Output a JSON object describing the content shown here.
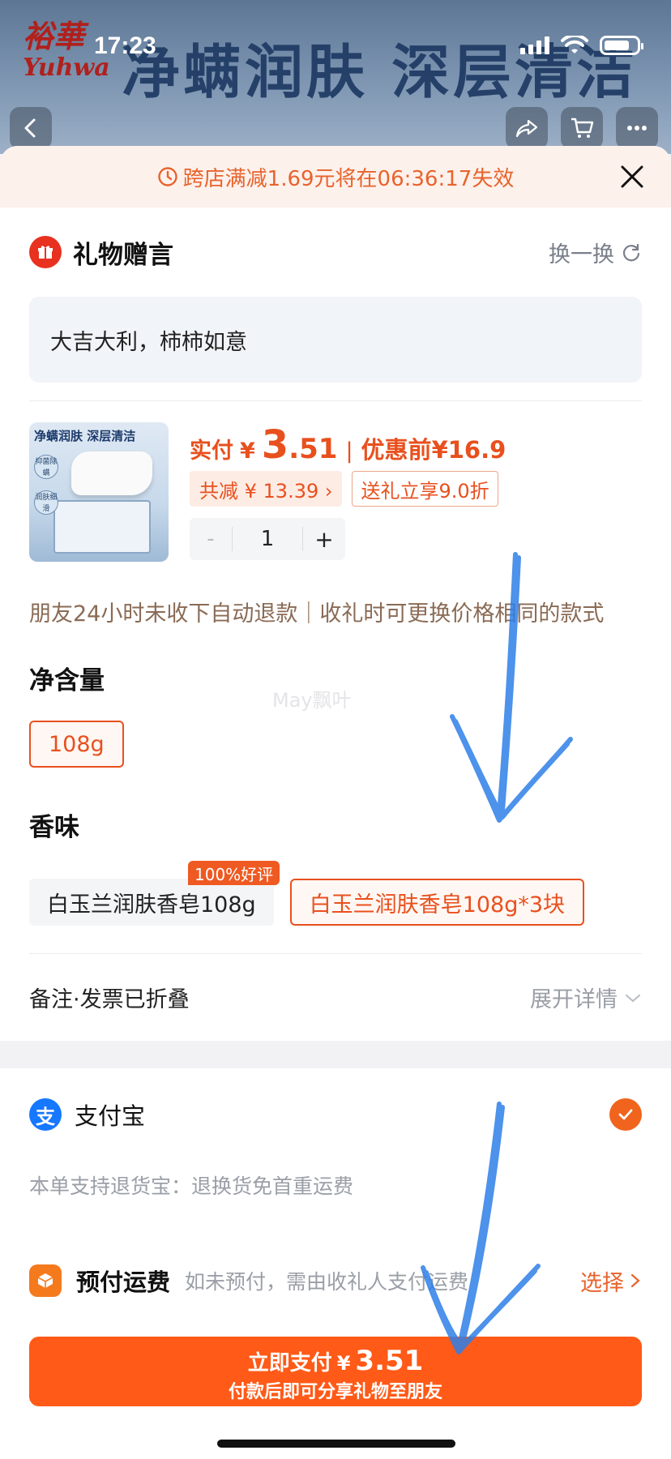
{
  "status_bar": {
    "time": "17:23"
  },
  "hero": {
    "brand_cn": "裕華",
    "brand_en": "Yuhwa",
    "title": "净螨润肤 深层清洁"
  },
  "promo": {
    "text": "跨店满减1.69元将在06:36:17失效"
  },
  "gift": {
    "title": "礼物赠言",
    "swap_label": "换一换",
    "message": "大吉大利，柿柿如意"
  },
  "product": {
    "thumb_title": "净螨润肤 深层清洁",
    "thumb_tags": [
      "抑菌除螨",
      "润肤细滑"
    ],
    "actual_label": "实付",
    "currency": "¥",
    "price_int": "3",
    "price_dec": ".51",
    "separator": "|",
    "before_label": "优惠前",
    "before_price": "¥16.9",
    "discount_chip": "共减 ¥ 13.39 ›",
    "gift_chip": "送礼立享9.0折",
    "qty_minus": "-",
    "qty": "1",
    "qty_plus": "+"
  },
  "notice": "朋友24小时未收下自动退款｜收礼时可更换价格相同的款式",
  "specs": {
    "net_label": "净含量",
    "net_options": [
      "108g"
    ],
    "scent_label": "香味",
    "scent_options": [
      "白玉兰润肤香皂108g",
      "白玉兰润肤香皂108g*3块"
    ],
    "badge": "100%好评"
  },
  "watermark": "May飘叶",
  "notes": {
    "label": "备注·发票已折叠",
    "expand": "展开详情"
  },
  "payment": {
    "method_icon": "支",
    "method": "支付宝",
    "refund_note": "本单支持退货宝：退换货免首重运费",
    "ship_label": "预付运费",
    "ship_hint": "如未预付，需由收礼人支付运费",
    "ship_choose": "选择"
  },
  "pay_button": {
    "label": "立即支付",
    "currency": "¥",
    "amount": "3.51",
    "sub": "付款后即可分享礼物至朋友"
  },
  "colors": {
    "accent": "#ff5a17",
    "price": "#e8501e",
    "alipay": "#1677ff",
    "annotation": "#2f80e8"
  }
}
